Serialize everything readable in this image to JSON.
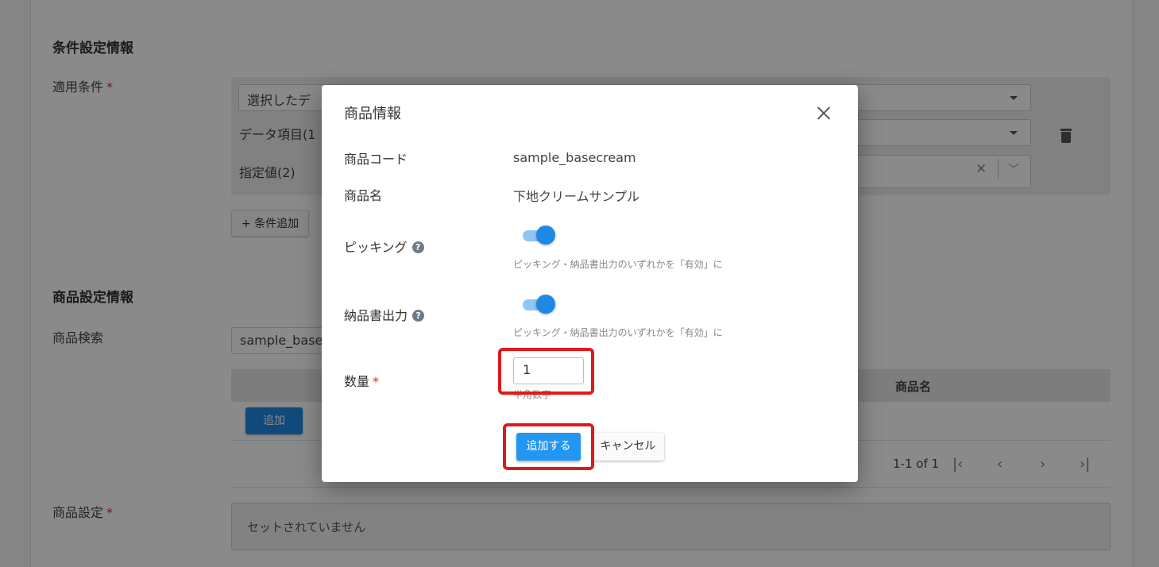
{
  "background": {
    "condition_section": {
      "title": "条件設定情報",
      "apply_condition_label": "適用条件",
      "required_mark": "*",
      "select_value": "選択したデ",
      "data_item_label": "データ項目(1",
      "specified_value_label": "指定値(2)",
      "add_condition_button": "+ 条件追加"
    },
    "product_section": {
      "title": "商品設定情報",
      "search_label": "商品検索",
      "search_value": "sample_base",
      "table_header_product_name": "商品名",
      "add_button": "追加",
      "pagination_text": "1-1 of 1",
      "product_setting_label": "商品設定",
      "product_setting_empty": "セットされていません"
    }
  },
  "modal": {
    "title": "商品情報",
    "product_code_label": "商品コード",
    "product_code_value": "sample_basecream",
    "product_name_label": "商品名",
    "product_name_value": "下地クリームサンプル",
    "picking_label": "ピッキング",
    "picking_enabled": true,
    "picking_hint": "ピッキング・納品書出力のいずれかを「有効」に",
    "delivery_note_label": "納品書出力",
    "delivery_note_enabled": true,
    "delivery_note_hint": "ピッキング・納品書出力のいずれかを「有効」に",
    "quantity_label": "数量",
    "quantity_required_mark": "*",
    "quantity_value": "1",
    "quantity_hint": "半角数字",
    "submit_button": "追加する",
    "cancel_button": "キャンセル"
  },
  "colors": {
    "primary": "#2196f3",
    "required": "#d32f2f",
    "highlight": "#e01919"
  }
}
